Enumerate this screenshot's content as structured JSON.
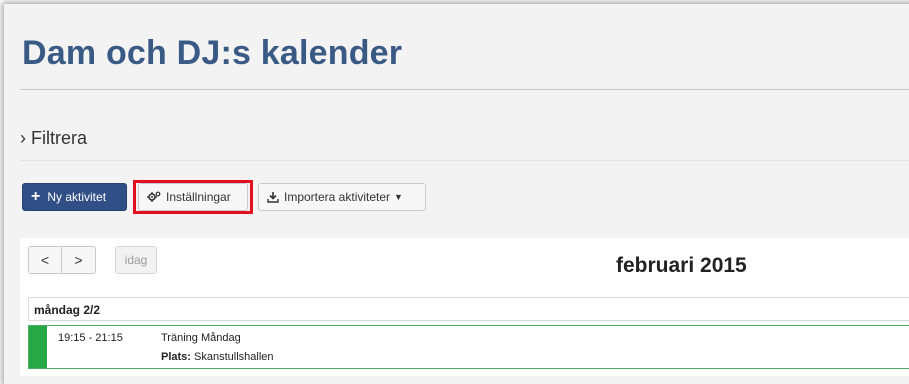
{
  "page": {
    "title": "Dam och DJ:s kalender",
    "filter_label": "Filtrera",
    "filter_chevron": "›"
  },
  "toolbar": {
    "new_activity_label": "Ny aktivitet",
    "settings_label": "Inställningar",
    "import_label": "Importera aktiviteter",
    "highlight_color": "#e0101e",
    "primary_color": "#2f4f86"
  },
  "calendar": {
    "prev_label": "<",
    "next_label": ">",
    "today_label": "idag",
    "month_title": "februari 2015",
    "day_header": "måndag 2/2",
    "events": [
      {
        "time": "19:15 - 21:15",
        "title": "Träning Måndag",
        "place_label": "Plats:",
        "place": "Skanstullshallen",
        "color": "#28a745"
      }
    ]
  },
  "icons": {
    "plus": "plus-icon",
    "settings": "cogs-icon",
    "import": "download-icon",
    "caret": "caret-down-icon"
  }
}
